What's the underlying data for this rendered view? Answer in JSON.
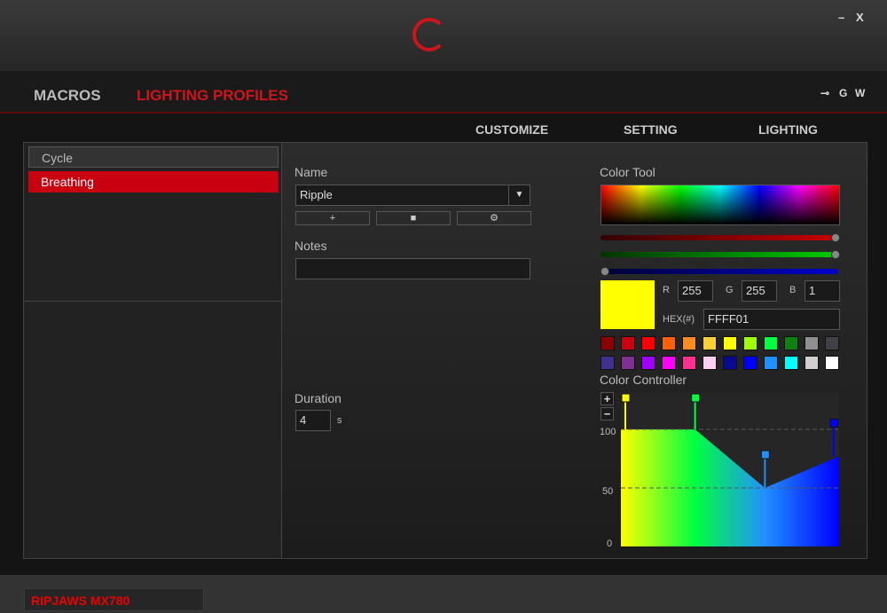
{
  "window": {
    "logo": "G.SKILL",
    "minimize": "–",
    "close": "X"
  },
  "nav": {
    "macros": "MACROS",
    "lighting_profiles": "LIGHTING PROFILES",
    "icons": [
      "⊸",
      "G",
      "W"
    ]
  },
  "subnav": {
    "customize": "CUSTOMIZE",
    "setting": "SETTING",
    "lighting": "LIGHTING"
  },
  "profiles": [
    {
      "label": "Cycle",
      "selected": false
    },
    {
      "label": "Breathing",
      "selected": true
    }
  ],
  "form": {
    "name_label": "Name",
    "name_value": "Ripple",
    "add": "+",
    "delete": "■",
    "settings": "⚙",
    "notes_label": "Notes",
    "notes_value": "",
    "duration_label": "Duration",
    "duration_value": "4",
    "duration_unit": "s"
  },
  "color_tool": {
    "title": "Color Tool",
    "r_label": "R",
    "r": "255",
    "g_label": "G",
    "g": "255",
    "b_label": "B",
    "b": "1",
    "hex_label": "HEX(#)",
    "hex": "FFFF01",
    "current": "#ffff01",
    "swatches": [
      "#8b0000",
      "#cc0010",
      "#ff0000",
      "#ff6000",
      "#ff8c20",
      "#ffd030",
      "#ffff00",
      "#a0ff00",
      "#00ff40",
      "#108010",
      "#909090",
      "#404048",
      "#403090",
      "#803090",
      "#a000ff",
      "#ff00ff",
      "#ff3090",
      "#ffd0f0",
      "#0a0a90",
      "#0000ff",
      "#2090ff",
      "#00ffff",
      "#d0d0d0",
      "#ffffff"
    ]
  },
  "color_controller": {
    "title": "Color Controller",
    "plus": "+",
    "minus": "−",
    "ticks": [
      "100",
      "50",
      "0"
    ],
    "points": [
      {
        "pos": 0,
        "value": 100,
        "color": "#ffff00"
      },
      {
        "pos": 0.34,
        "value": 100,
        "color": "#00ff40"
      },
      {
        "pos": 0.66,
        "value": 50,
        "color": "#2090ff"
      },
      {
        "pos": 1,
        "value": 77,
        "color": "#0000ff"
      }
    ]
  },
  "footer": {
    "device": "RIPJAWS MX780"
  }
}
